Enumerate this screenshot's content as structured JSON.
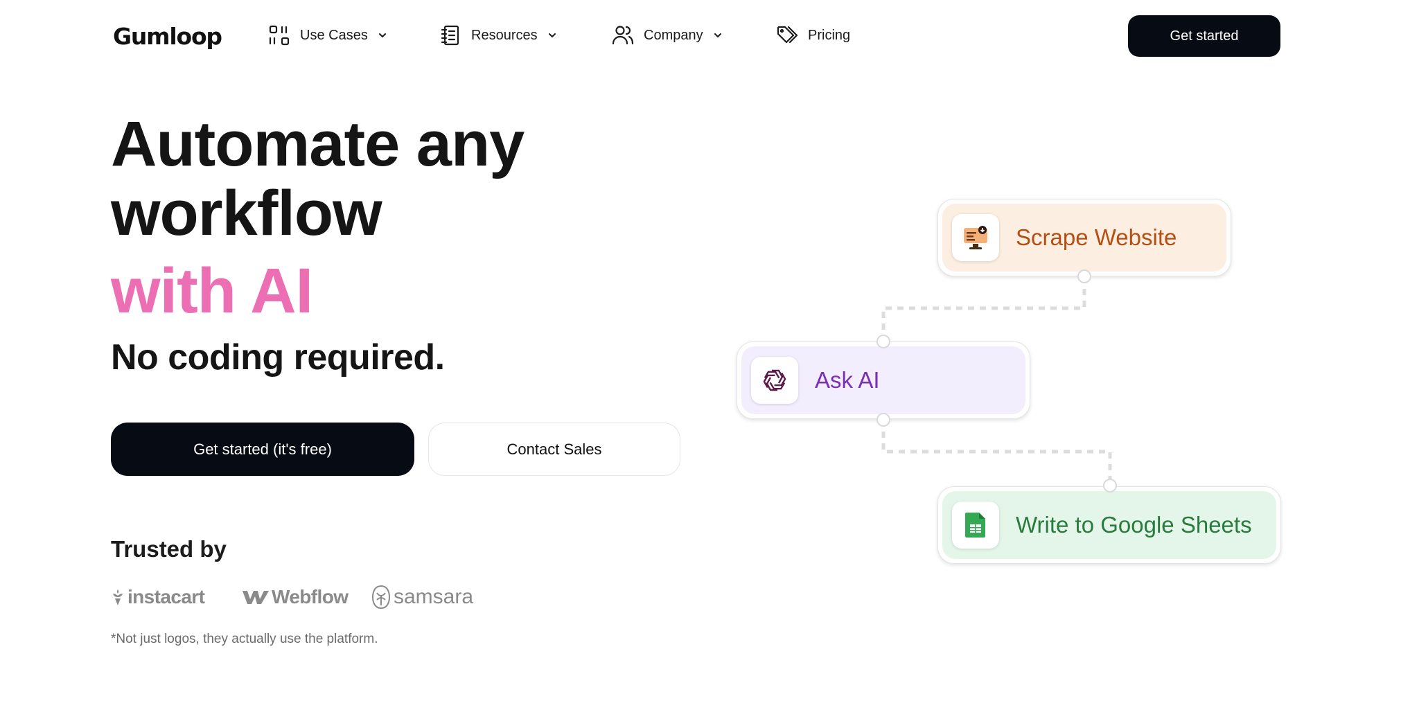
{
  "brand": {
    "logo_text": "Gumloop"
  },
  "nav": {
    "items": [
      {
        "label": "Use Cases",
        "icon": "use-cases-icon",
        "has_dropdown": true
      },
      {
        "label": "Resources",
        "icon": "notebook-icon",
        "has_dropdown": true
      },
      {
        "label": "Company",
        "icon": "users-icon",
        "has_dropdown": true
      },
      {
        "label": "Pricing",
        "icon": "price-tag-icon",
        "has_dropdown": false
      }
    ],
    "cta_label": "Get started"
  },
  "hero": {
    "headline_line1": "Automate any",
    "headline_line2": "workflow",
    "headline_accent": "with AI",
    "subheadline": "No coding required.",
    "primary_cta": "Get started (it's free)",
    "secondary_cta": "Contact Sales"
  },
  "trust": {
    "heading": "Trusted by",
    "logos": [
      "instacart",
      "Webflow",
      "samsara"
    ],
    "footnote": "*Not just logos, they actually use the platform."
  },
  "workflow": {
    "nodes": [
      {
        "label": "Scrape Website",
        "icon": "scrape-website-icon"
      },
      {
        "label": "Ask AI",
        "icon": "openai-icon"
      },
      {
        "label": "Write to Google Sheets",
        "icon": "google-sheets-icon"
      }
    ]
  },
  "colors": {
    "accent_pink": "#ec6fb4",
    "button_dark": "#070b14",
    "scrape_bg": "#fdeee2",
    "scrape_text": "#b44f14",
    "ask_bg": "#f3eefd",
    "ask_text": "#7a2fb8",
    "sheets_bg": "#e4f6ea",
    "sheets_text": "#2b7a3d"
  }
}
